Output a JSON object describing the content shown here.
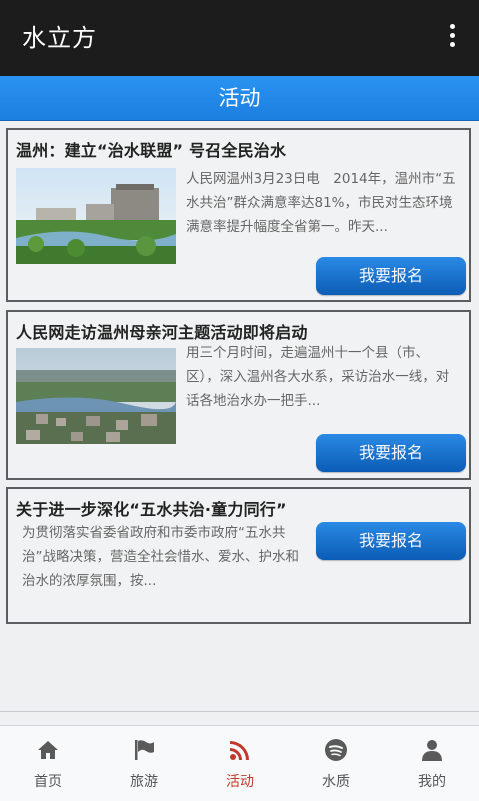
{
  "app": {
    "title": "水立方"
  },
  "section": {
    "title": "活动"
  },
  "activities": [
    {
      "title": "温州：建立“治水联盟” 号召全民治水",
      "excerpt": "人民网温州3月23日电　2014年，温州市“五水共治”群众满意率达81%，市民对生态环境满意率提升幅度全省第一。昨天...",
      "button": "我要报名"
    },
    {
      "title": "人民网走访温州母亲河主题活动即将启动",
      "excerpt": "用三个月时间，走遍温州十一个县（市、区），深入温州各大水系，采访治水一线，对话各地治水办一把手...",
      "button": "我要报名"
    },
    {
      "title": "关于进一步深化“五水共治·童力同行”",
      "excerpt": "为贯彻落实省委省政府和市委市政府“五水共治”战略决策，营造全社会惜水、爱水、护水和治水的浓厚氛围，按...",
      "button": "我要报名"
    }
  ],
  "tabs": [
    {
      "label": "首页",
      "icon": "home-icon"
    },
    {
      "label": "旅游",
      "icon": "flag-icon"
    },
    {
      "label": "活动",
      "icon": "rss-icon",
      "active": true
    },
    {
      "label": "水质",
      "icon": "spotify-icon"
    },
    {
      "label": "我的",
      "icon": "user-icon"
    }
  ],
  "colors": {
    "appbar": "#1c1c1c",
    "section_bar": "#1f86e6",
    "button": "#1a74d4",
    "active_tab": "#c0392b"
  }
}
